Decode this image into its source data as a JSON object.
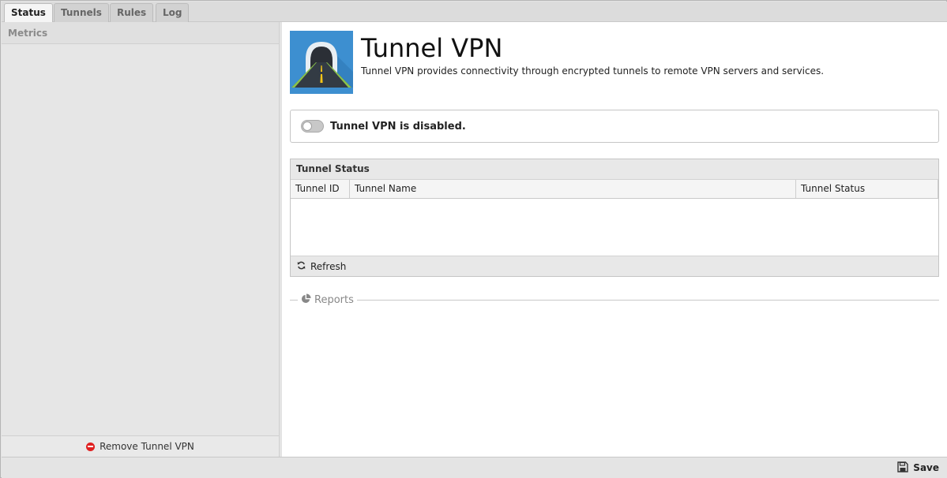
{
  "tabs": [
    {
      "label": "Status",
      "active": true
    },
    {
      "label": "Tunnels",
      "active": false
    },
    {
      "label": "Rules",
      "active": false
    },
    {
      "label": "Log",
      "active": false
    }
  ],
  "left_panel": {
    "title": "Metrics",
    "remove_label": "Remove Tunnel VPN"
  },
  "app": {
    "icon": "tunnel-road-icon",
    "title": "Tunnel VPN",
    "description": "Tunnel VPN provides connectivity through encrypted tunnels to remote VPN servers and services."
  },
  "status": {
    "enabled": false,
    "text": "Tunnel VPN is disabled."
  },
  "tunnel_grid": {
    "title": "Tunnel Status",
    "columns": [
      "Tunnel ID",
      "Tunnel Name",
      "Tunnel Status"
    ],
    "rows": [],
    "refresh_label": "Refresh"
  },
  "reports": {
    "label": "Reports",
    "icon": "pie-chart-icon"
  },
  "bottom_bar": {
    "save_label": "Save",
    "save_icon": "floppy-disk-icon"
  },
  "colors": {
    "icon_background": "#3d8fd0",
    "remove_icon": "#e02020"
  }
}
